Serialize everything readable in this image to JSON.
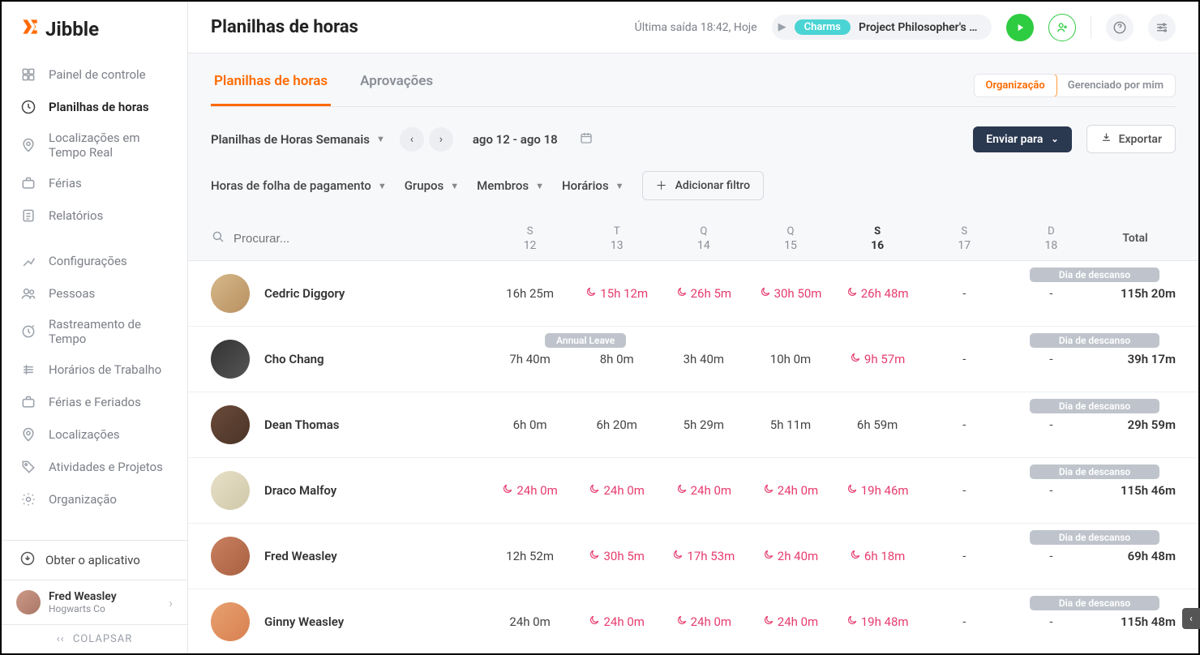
{
  "logo_text": "Jibble",
  "sidebar": {
    "items": [
      {
        "label": "Painel de controle",
        "icon": "dashboard"
      },
      {
        "label": "Planilhas de horas",
        "icon": "clock",
        "active": true
      },
      {
        "label": "Localizações em Tempo Real",
        "icon": "pin"
      },
      {
        "label": "Férias",
        "icon": "briefcase"
      },
      {
        "label": "Relatórios",
        "icon": "report"
      }
    ],
    "items2": [
      {
        "label": "Configurações",
        "icon": "sliders"
      },
      {
        "label": "Pessoas",
        "icon": "people"
      },
      {
        "label": "Rastreamento de Tempo",
        "icon": "tracking"
      },
      {
        "label": "Horários de Trabalho",
        "icon": "schedule"
      },
      {
        "label": "Férias e Feriados",
        "icon": "briefcase"
      },
      {
        "label": "Localizações",
        "icon": "pin"
      },
      {
        "label": "Atividades e Projetos",
        "icon": "tag"
      },
      {
        "label": "Organização",
        "icon": "gear"
      }
    ],
    "get_app": "Obter o aplicativo",
    "user": {
      "name": "Fred Weasley",
      "org": "Hogwarts Co"
    },
    "collapse": "COLAPSAR"
  },
  "header": {
    "title": "Planilhas de horas",
    "last_exit": "Última saída 18:42, Hoje",
    "tag": "Charms",
    "project": "Project Philosopher's St..."
  },
  "tabs": {
    "timesheets": "Planilhas de horas",
    "approvals": "Aprovações"
  },
  "scope": {
    "org": "Organização",
    "mine": "Gerenciado por mim"
  },
  "toolbar": {
    "period": "Planilhas de Horas Semanais",
    "date_range": "ago 12 - ago 18",
    "send": "Enviar para",
    "export": "Exportar"
  },
  "filters": {
    "payroll": "Horas de folha de pagamento",
    "groups": "Grupos",
    "members": "Membros",
    "schedules": "Horários",
    "add": "Adicionar filtro"
  },
  "search_placeholder": "Procurar...",
  "days": [
    {
      "abbr": "S",
      "num": "12"
    },
    {
      "abbr": "T",
      "num": "13"
    },
    {
      "abbr": "Q",
      "num": "14"
    },
    {
      "abbr": "Q",
      "num": "15"
    },
    {
      "abbr": "S",
      "num": "16",
      "today": true
    },
    {
      "abbr": "S",
      "num": "17"
    },
    {
      "abbr": "D",
      "num": "18"
    }
  ],
  "total_label": "Total",
  "rest_badge": "Dia de descanso",
  "leave_badge": "Annual Leave",
  "rows": [
    {
      "name": "Cedric Diggory",
      "cells": [
        {
          "v": "16h 25m"
        },
        {
          "v": "15h 12m",
          "over": true
        },
        {
          "v": "26h 5m",
          "over": true
        },
        {
          "v": "30h 50m",
          "over": true
        },
        {
          "v": "26h 48m",
          "over": true
        },
        {
          "v": "-"
        },
        {
          "v": "-"
        }
      ],
      "total": "115h 20m"
    },
    {
      "name": "Cho Chang",
      "leave": true,
      "cells": [
        {
          "v": "7h 40m"
        },
        {
          "v": "8h 0m"
        },
        {
          "v": "3h 40m"
        },
        {
          "v": "10h 0m"
        },
        {
          "v": "9h 57m",
          "over": true
        },
        {
          "v": "-"
        },
        {
          "v": "-"
        }
      ],
      "total": "39h 17m"
    },
    {
      "name": "Dean Thomas",
      "cells": [
        {
          "v": "6h 0m"
        },
        {
          "v": "6h 20m"
        },
        {
          "v": "5h 29m"
        },
        {
          "v": "5h 11m"
        },
        {
          "v": "6h 59m"
        },
        {
          "v": "-"
        },
        {
          "v": "-"
        }
      ],
      "total": "29h 59m"
    },
    {
      "name": "Draco Malfoy",
      "cells": [
        {
          "v": "24h 0m",
          "over": true
        },
        {
          "v": "24h 0m",
          "over": true
        },
        {
          "v": "24h 0m",
          "over": true
        },
        {
          "v": "24h 0m",
          "over": true
        },
        {
          "v": "19h 46m",
          "over": true
        },
        {
          "v": "-"
        },
        {
          "v": "-"
        }
      ],
      "total": "115h 46m"
    },
    {
      "name": "Fred Weasley",
      "cells": [
        {
          "v": "12h 52m"
        },
        {
          "v": "30h 5m",
          "over": true
        },
        {
          "v": "17h 53m",
          "over": true
        },
        {
          "v": "2h 40m",
          "over": true
        },
        {
          "v": "6h 18m",
          "over": true
        },
        {
          "v": "-"
        },
        {
          "v": "-"
        }
      ],
      "total": "69h 48m"
    },
    {
      "name": "Ginny Weasley",
      "cells": [
        {
          "v": "24h 0m"
        },
        {
          "v": "24h 0m",
          "over": true
        },
        {
          "v": "24h 0m",
          "over": true
        },
        {
          "v": "24h 0m",
          "over": true
        },
        {
          "v": "19h 48m",
          "over": true
        },
        {
          "v": "-"
        },
        {
          "v": "-"
        }
      ],
      "total": "115h 48m"
    }
  ]
}
